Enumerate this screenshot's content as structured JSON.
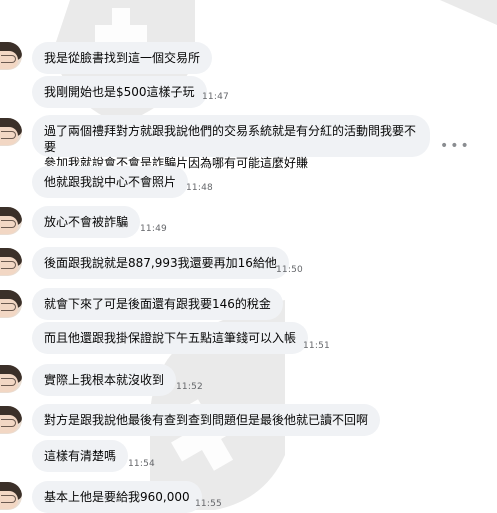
{
  "messages": [
    {
      "text": "我是從臉書找到這一個交易所",
      "time": ""
    },
    {
      "text": "我剛開始也是$500這樣子玩",
      "time": "11:47"
    },
    {
      "line1": "過了兩個禮拜對方就跟我說他們的交易系統就是有分紅的活動問我要不要",
      "line2": "參加我就說會不會是詐騙片因為哪有可能這麼好賺",
      "time": ""
    },
    {
      "text": "他就跟我說中心不會照片",
      "time": "11:48"
    },
    {
      "text": "放心不會被詐騙",
      "time": "11:49"
    },
    {
      "text": "後面跟我說就是887,993我還要再加16給他",
      "time": "11:50"
    },
    {
      "text": "就會下來了可是後面還有跟我要146的稅金",
      "time": ""
    },
    {
      "text": "而且他還跟我掛保證說下午五點這筆錢可以入帳",
      "time": "11:51"
    },
    {
      "text": "實際上我根本就沒收到",
      "time": "11:52"
    },
    {
      "text": "對方是跟我說他最後有查到查到問題但是最後他就已讀不回啊",
      "time": ""
    },
    {
      "text": "這樣有清楚嗎",
      "time": "11:54"
    },
    {
      "text": "基本上他是要給我960,000",
      "time": "11:55"
    }
  ],
  "more_icon": "more-horizontal-icon",
  "colors": {
    "bubble": "#f0f2f5",
    "text": "#050505",
    "time": "#65676b"
  }
}
